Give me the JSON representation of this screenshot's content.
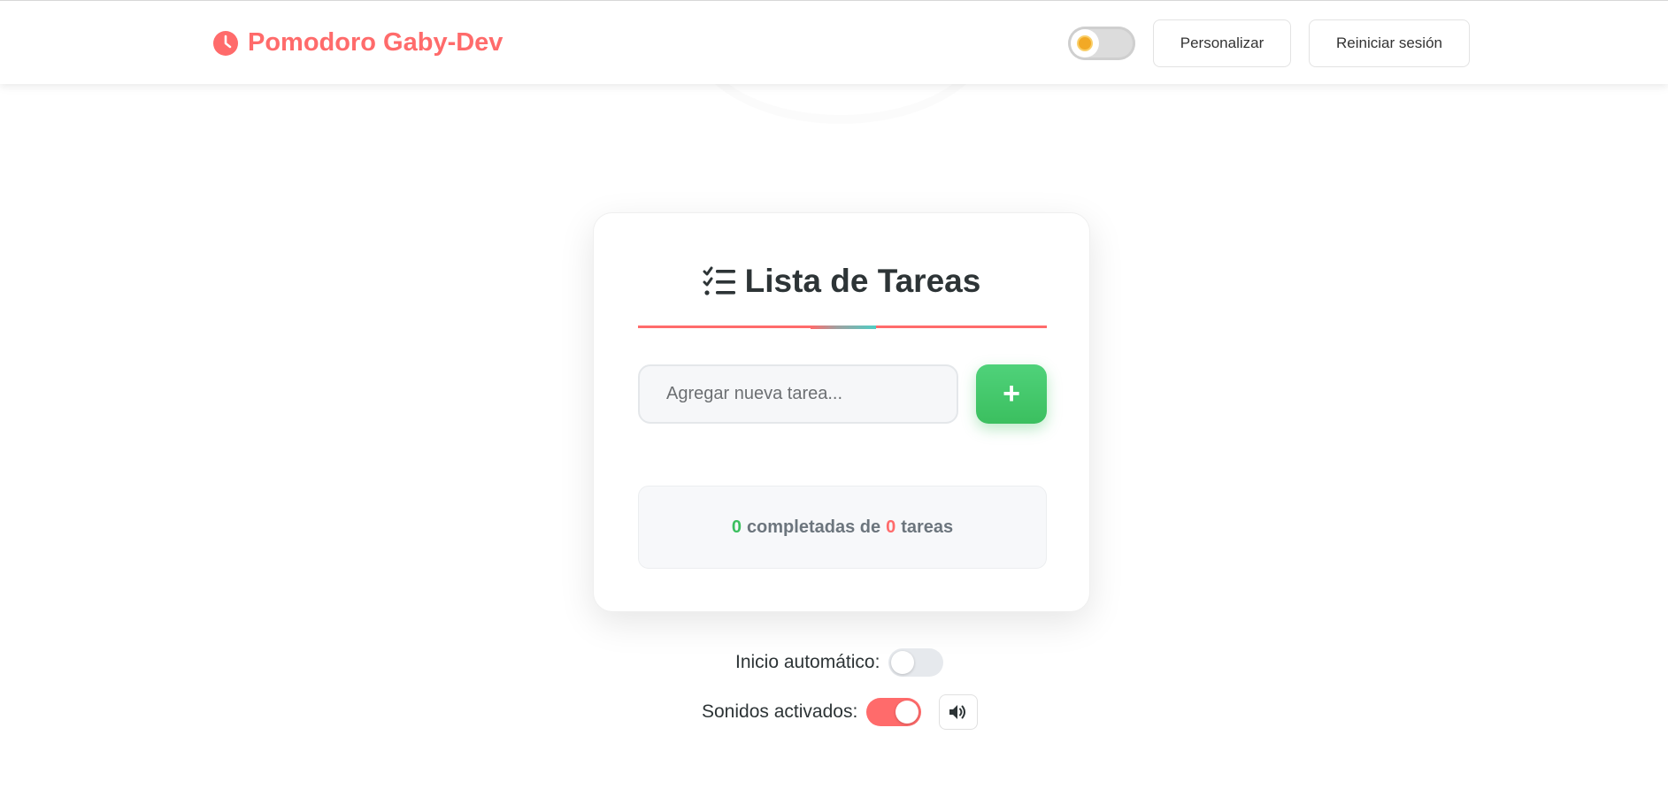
{
  "header": {
    "brand": "Pomodoro Gaby-Dev",
    "theme_toggle_icon": "sun-icon",
    "customize_label": "Personalizar",
    "reset_label": "Reiniciar sesión"
  },
  "tasks": {
    "title": "Lista de Tareas",
    "title_icon": "checklist-icon",
    "input_placeholder": "Agregar nueva tarea...",
    "add_label": "+",
    "completed_count": "0",
    "completed_text": "completadas de",
    "total_count": "0",
    "total_text": "tareas"
  },
  "settings": {
    "auto_start_label": "Inicio automático:",
    "auto_start_on": false,
    "sounds_label": "Sonidos activados:",
    "sounds_on": true,
    "volume_icon": "volume-icon"
  },
  "colors": {
    "accent": "#ff6b6b",
    "success": "#3bbf5f",
    "teal": "#4ecdc4"
  }
}
